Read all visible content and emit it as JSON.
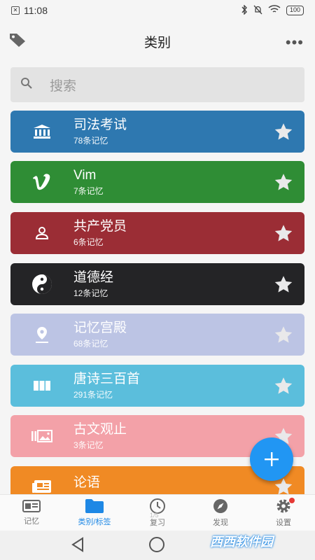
{
  "status": {
    "time": "11:08",
    "battery": "100"
  },
  "header": {
    "title": "类别",
    "more_label": "•••"
  },
  "search": {
    "placeholder": "搜索"
  },
  "categories": [
    {
      "name": "司法考试",
      "count": "78条记忆",
      "color": "#2e78b0",
      "icon": "bank-icon"
    },
    {
      "name": "Vim",
      "count": "7条记忆",
      "color": "#2f8d35",
      "icon": "vimeo-icon"
    },
    {
      "name": "共产党员",
      "count": "6条记忆",
      "color": "#9b2d35",
      "icon": "person-icon"
    },
    {
      "name": "道德经",
      "count": "12条记忆",
      "color": "#242426",
      "icon": "yin-yang-icon"
    },
    {
      "name": "记忆宫殿",
      "count": "68条记忆",
      "color": "#bcc4e4",
      "icon": "location-pin-icon"
    },
    {
      "name": "唐诗三百首",
      "count": "291条记忆",
      "color": "#5bbedc",
      "icon": "columns-icon"
    },
    {
      "name": "古文观止",
      "count": "3条记忆",
      "color": "#f3a1a8",
      "icon": "gallery-icon"
    },
    {
      "name": "论语",
      "count": "",
      "color": "#f08a24",
      "icon": "newspaper-icon"
    }
  ],
  "nav": {
    "items": [
      {
        "label": "记忆"
      },
      {
        "label": "类别/标签"
      },
      {
        "label": "复习"
      },
      {
        "label": "发现"
      },
      {
        "label": "设置"
      }
    ],
    "page_indicator": "1/5"
  },
  "watermark": "西西软件园"
}
